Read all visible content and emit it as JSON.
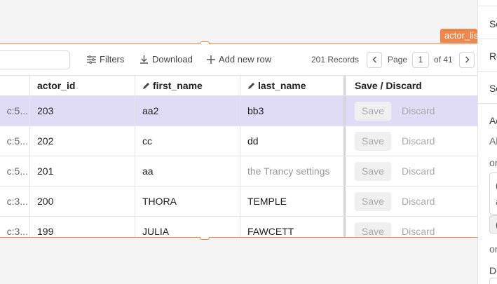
{
  "widget_tag": "actor_lis",
  "toolbar": {
    "filters_label": "Filters",
    "download_label": "Download",
    "add_row_label": "Add new row",
    "records_label": "201 Records",
    "page_label": "Page",
    "page_value": "1",
    "of_pages_label": "of 41"
  },
  "table": {
    "headers": [
      "actor_id",
      "first_name",
      "last_name",
      "Save / Discard"
    ],
    "save_label": "Save",
    "discard_label": "Discard",
    "rows": [
      {
        "prefix": "c:5...",
        "actor_id": "203",
        "first_name": "aa2",
        "last_name": "bb3"
      },
      {
        "prefix": "c:5...",
        "actor_id": "202",
        "first_name": "cc",
        "last_name": "dd"
      },
      {
        "prefix": "c:5...",
        "actor_id": "201",
        "first_name": "aa",
        "last_name": ""
      },
      {
        "prefix": "c:3...",
        "actor_id": "200",
        "first_name": "THORA",
        "last_name": "TEMPLE"
      },
      {
        "prefix": "c:3...",
        "actor_id": "199",
        "first_name": "JULIA",
        "last_name": "FAWCETT"
      }
    ],
    "overlay_text": "the Trancy settings"
  },
  "panel": {
    "items": [
      "Se",
      "Ro",
      "So",
      "Ac",
      "Al",
      "or",
      "or",
      "De"
    ],
    "box_items": [
      "(",
      "a",
      "("
    ]
  },
  "colors": {
    "accent": "#f0864a",
    "selected_row": "#e0dcf7"
  }
}
